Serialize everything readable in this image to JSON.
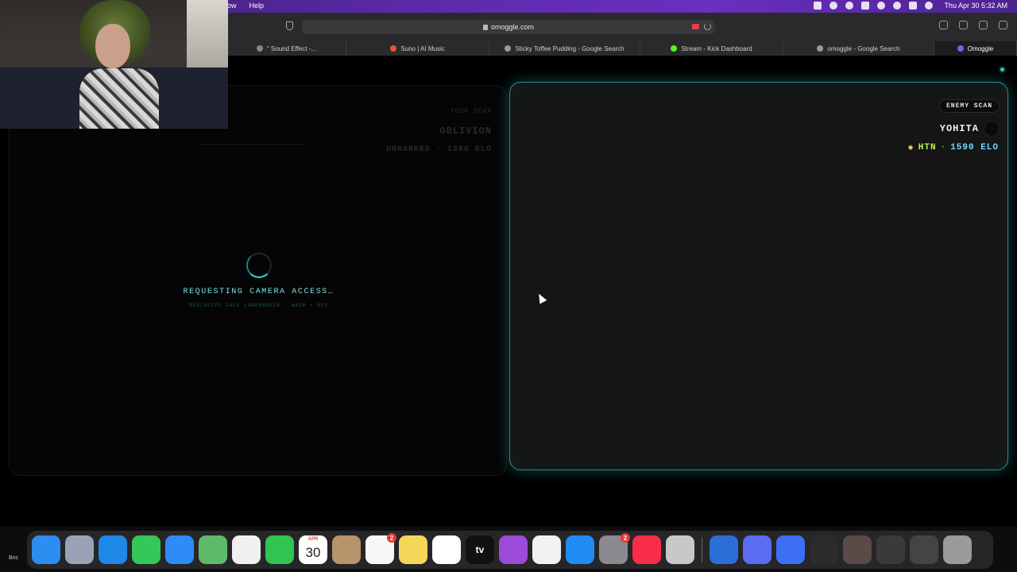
{
  "menubar": {
    "menus": [
      "ow",
      "Help"
    ],
    "clock": "Thu Apr 30  5:32 AM",
    "status_icons": [
      "camera-icon",
      "screen-record-icon",
      "wifi-icon",
      "volume-icon",
      "play-icon",
      "search-icon",
      "control-center-icon",
      "siri-icon"
    ]
  },
  "browser": {
    "url": "omoggle.com",
    "tabs": [
      {
        "label": "\" Sound Effect -...",
        "fav_color": "#888888",
        "active": false
      },
      {
        "label": "Suno | AI Music",
        "fav_color": "#e8572a",
        "active": false
      },
      {
        "label": "Sticky Toffee Pudding - Google Search",
        "fav_color": "#999999",
        "active": false
      },
      {
        "label": "Stream - Kick Dashboard",
        "fav_color": "#53fc18",
        "active": false
      },
      {
        "label": "omoggle - Google Search",
        "fav_color": "#999999",
        "active": false
      },
      {
        "label": "Omoggle",
        "fav_color": "#7a5cff",
        "active": true
      }
    ]
  },
  "left_panel": {
    "ghost_label": "YOUR SCAN",
    "ghost_name": "OBLIVION",
    "ghost_rank": "UNRANKED · 1368 ELO",
    "status": "REQUESTING CAMERA ACCESS…",
    "sub_status": "MEDIAPIPE FACE LANDMARKER · WASM + GPU"
  },
  "right_panel": {
    "badge": "ENEMY SCAN",
    "name": "YOHITA",
    "country": "HTN",
    "separator": "·",
    "elo": "1590 ELO"
  },
  "dock": {
    "apps": [
      {
        "name": "finder",
        "color": "#2d8ef0",
        "label": "",
        "badge": ""
      },
      {
        "name": "launchpad",
        "color": "#9aa3b5",
        "label": "",
        "badge": ""
      },
      {
        "name": "safari",
        "color": "#1e88e5",
        "label": "",
        "badge": ""
      },
      {
        "name": "messages",
        "color": "#34c759",
        "label": "",
        "badge": ""
      },
      {
        "name": "mail",
        "color": "#2f8cf6",
        "label": "",
        "badge": ""
      },
      {
        "name": "maps",
        "color": "#5fb96a",
        "label": "",
        "badge": ""
      },
      {
        "name": "photos",
        "color": "#f0f0f0",
        "label": "",
        "badge": ""
      },
      {
        "name": "facetime",
        "color": "#31c450",
        "label": "",
        "badge": ""
      },
      {
        "name": "calendar",
        "color": "#ffffff",
        "label": "",
        "badge": ""
      },
      {
        "name": "contacts",
        "color": "#b8946a",
        "label": "",
        "badge": ""
      },
      {
        "name": "reminders",
        "color": "#f7f7f7",
        "label": "",
        "badge": "2"
      },
      {
        "name": "notes",
        "color": "#f6d659",
        "label": "",
        "badge": ""
      },
      {
        "name": "freeform",
        "color": "#ffffff",
        "label": "",
        "badge": ""
      },
      {
        "name": "apple-tv",
        "color": "#111111",
        "label": "tv",
        "badge": ""
      },
      {
        "name": "podcasts",
        "color": "#9b4bd8",
        "label": "",
        "badge": ""
      },
      {
        "name": "news",
        "color": "#f2f2f2",
        "label": "",
        "badge": ""
      },
      {
        "name": "app-store",
        "color": "#1f8bf3",
        "label": "",
        "badge": ""
      },
      {
        "name": "system-settings",
        "color": "#8a8a8e",
        "label": "",
        "badge": "2"
      },
      {
        "name": "music",
        "color": "#fa2d48",
        "label": "",
        "badge": ""
      },
      {
        "name": "compressor",
        "color": "#c8c8c8",
        "label": "",
        "badge": ""
      }
    ],
    "apps_right": [
      {
        "name": "quicktime",
        "color": "#2a6fd6",
        "label": "",
        "badge": ""
      },
      {
        "name": "arc-browser",
        "color": "#5a6cf0",
        "label": "",
        "badge": ""
      },
      {
        "name": "nordvpn",
        "color": "#3d6ff5",
        "label": "",
        "badge": ""
      },
      {
        "name": "obs-studio",
        "color": "#2b2b2b",
        "label": "",
        "badge": ""
      },
      {
        "name": "recent-window-1",
        "color": "#5a4a48",
        "label": "",
        "badge": ""
      },
      {
        "name": "recent-window-2",
        "color": "#3a3a3a",
        "label": "",
        "badge": ""
      },
      {
        "name": "recent-window-3",
        "color": "#444444",
        "label": "",
        "badge": ""
      },
      {
        "name": "trash",
        "color": "#9a9a9a",
        "label": "",
        "badge": ""
      }
    ],
    "calendar_month": "APR",
    "calendar_day": "30"
  },
  "corner_label": "Bnc",
  "colors": {
    "accent": "#2fc7c2",
    "country": "#b9f04a",
    "elo": "#6fd8ff"
  }
}
